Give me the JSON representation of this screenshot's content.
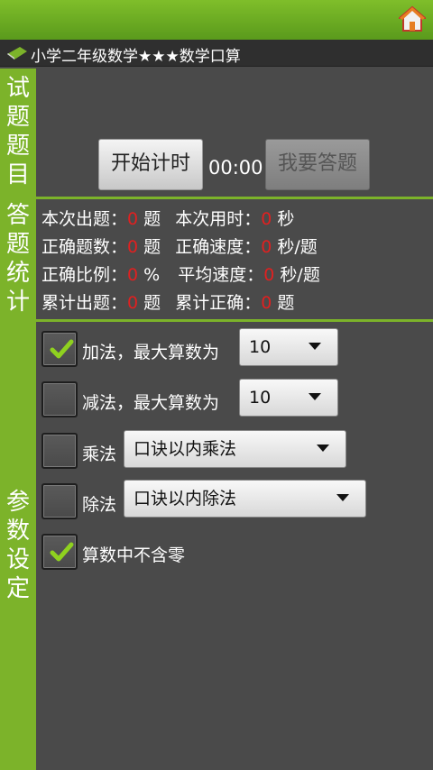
{
  "header": {
    "title": "小学二年级数学★★★数学口算"
  },
  "sections": {
    "questions_label": [
      "试",
      "题",
      "题",
      "目"
    ],
    "stats_label": [
      "答",
      "题",
      "统",
      "计"
    ],
    "settings_label": [
      "参",
      "数",
      "设",
      "定"
    ]
  },
  "timer_panel": {
    "start_button": "开始计时",
    "time": "00:00",
    "answer_button": "我要答题"
  },
  "stats": {
    "row1": {
      "l1": "本次出题：",
      "v1": "0",
      "u1": "题",
      "l2": "本次用时：",
      "v2": "0",
      "u2": "秒"
    },
    "row2": {
      "l1": "正确题数：",
      "v1": "0",
      "u1": "题",
      "l2": "正确速度：",
      "v2": "0",
      "u2": "秒/题"
    },
    "row3": {
      "l1": "正确比例：",
      "v1": "0",
      "u1": "%",
      "l2": "平均速度：",
      "v2": "0",
      "u2": "秒/题"
    },
    "row4": {
      "l1": "累计出题：",
      "v1": "0",
      "u1": "题",
      "l2": "累计正确：",
      "v2": "0",
      "u2": "题"
    }
  },
  "settings": {
    "add": {
      "label": "加法，最大算数为",
      "value": "10",
      "checked": true
    },
    "sub": {
      "label": "减法，最大算数为",
      "value": "10",
      "checked": false
    },
    "mul": {
      "label": "乘法",
      "value": "口诀以内乘法",
      "checked": false
    },
    "div": {
      "label": "除法",
      "value": "口诀以内除法",
      "checked": false
    },
    "nozero": {
      "label": "算数中不含零",
      "checked": true
    }
  },
  "colors": {
    "accent_green": "#7cb32a",
    "value_red": "#e02020",
    "background": "#4a4a4a"
  },
  "icons": {
    "home": "home-icon",
    "book": "book-icon",
    "check": "check-icon"
  }
}
